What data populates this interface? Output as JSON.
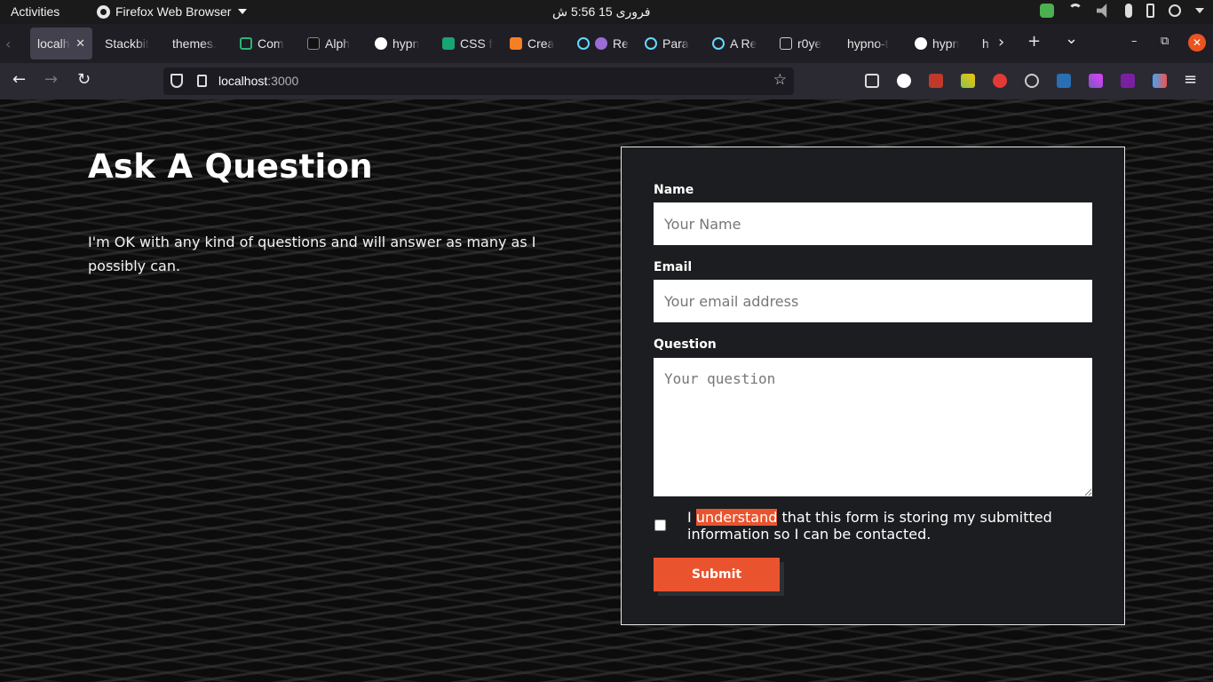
{
  "system_bar": {
    "activities": "Activities",
    "app_name": "Firefox Web Browser",
    "clock": "فروری 15  5:56 ش"
  },
  "tabs": [
    {
      "label": "localh",
      "active": true,
      "close": "✕"
    },
    {
      "label": "Stackbit"
    },
    {
      "label": "themes."
    },
    {
      "label": "Com"
    },
    {
      "label": "Alph"
    },
    {
      "label": "hypn"
    },
    {
      "label": "CSS f"
    },
    {
      "label": "Crea"
    },
    {
      "label": "Re"
    },
    {
      "label": "Para"
    },
    {
      "label": "A Re"
    },
    {
      "label": "r0ye"
    },
    {
      "label": "hypno-t"
    },
    {
      "label": "hypn"
    },
    {
      "label": "h"
    }
  ],
  "tab_strip": {
    "scroll_left": "‹",
    "scroll_right": "›",
    "new_tab": "+",
    "list_all": "⌄",
    "minimize": "–",
    "restore": "⧉",
    "close": "✕"
  },
  "nav": {
    "back": "←",
    "forward": "→",
    "reload": "↻",
    "url_host": "localhost",
    "url_port": ":3000",
    "bookmark_star": "☆",
    "menu": "≡"
  },
  "page": {
    "title": "Ask A Question",
    "description": "I'm OK with any kind of questions and will answer as many as I possibly can."
  },
  "form": {
    "name_label": "Name",
    "name_placeholder": "Your Name",
    "email_label": "Email",
    "email_placeholder": "Your email address",
    "question_label": "Question",
    "question_placeholder": "Your question",
    "consent_prefix": "I ",
    "consent_highlight": "understand",
    "consent_suffix": " that this form is storing my submitted information so I can be contacted.",
    "submit_label": "Submit"
  },
  "colors": {
    "accent": "#e9542f",
    "form_bg": "#1b1d20",
    "close_button": "#e95420"
  }
}
